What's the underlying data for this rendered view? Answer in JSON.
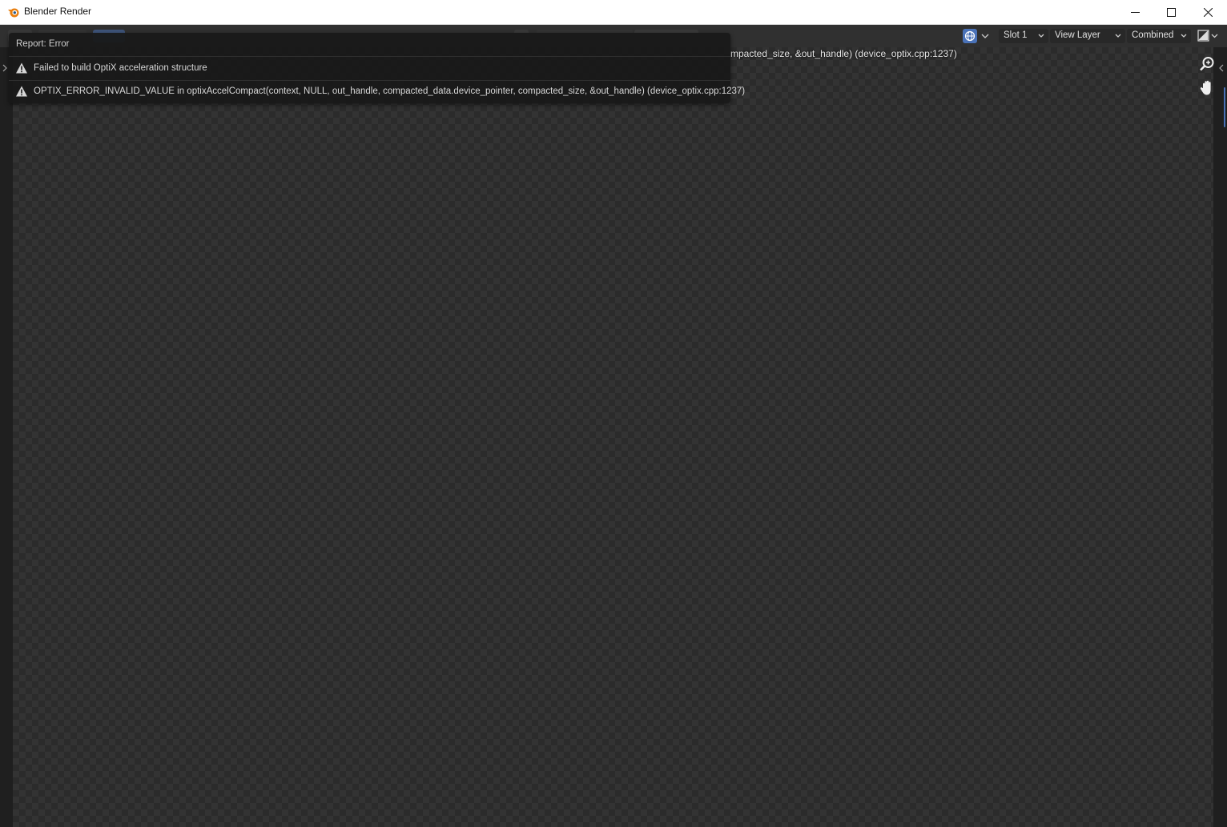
{
  "window": {
    "title": "Blender Render"
  },
  "header": {
    "slot": "Slot 1",
    "view_layer": "View Layer",
    "pass": "Combined"
  },
  "status_line": "mpacted_size, &out_handle) (device_optix.cpp:1237)",
  "report": {
    "title": "Report: Error",
    "items": [
      {
        "text": "Failed to build OptiX acceleration structure",
        "icon": "warning-icon"
      },
      {
        "text": "OPTIX_ERROR_INVALID_VALUE in optixAccelCompact(context, NULL, out_handle, compacted_data.device_pointer, compacted_size, &out_handle) (device_optix.cpp:1237)",
        "icon": "warning-icon"
      }
    ]
  },
  "colors": {
    "header_bg": "#303030",
    "accent_blue": "#4a72b8"
  }
}
